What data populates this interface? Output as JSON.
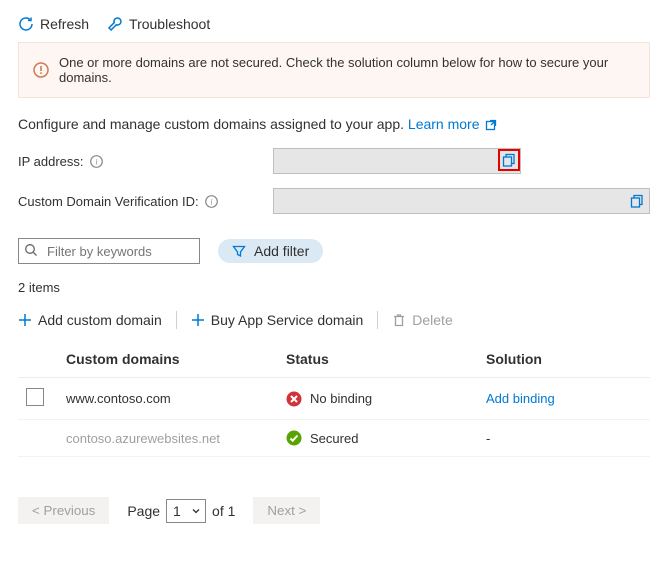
{
  "toolbar": {
    "refresh_label": "Refresh",
    "troubleshoot_label": "Troubleshoot"
  },
  "warning": {
    "message": "One or more domains are not secured. Check the solution column below for how to secure your domains."
  },
  "intro": {
    "text": "Configure and manage custom domains assigned to your app. ",
    "learn_more_label": "Learn more"
  },
  "fields": {
    "ip_label": "IP address:",
    "ip_value": "",
    "cdv_label": "Custom Domain Verification ID:",
    "cdv_value": ""
  },
  "filter": {
    "placeholder": "Filter by keywords",
    "add_filter_label": "Add filter"
  },
  "count_text": "2 items",
  "actions": {
    "add_domain_label": "Add custom domain",
    "buy_domain_label": "Buy App Service domain",
    "delete_label": "Delete"
  },
  "table": {
    "headers": {
      "domain": "Custom domains",
      "status": "Status",
      "solution": "Solution"
    },
    "rows": [
      {
        "selectable": true,
        "domain": "www.contoso.com",
        "status_icon": "error",
        "status_text": "No binding",
        "solution_text": "Add binding",
        "solution_is_link": true,
        "muted": false
      },
      {
        "selectable": false,
        "domain": "contoso.azurewebsites.net",
        "status_icon": "success",
        "status_text": "Secured",
        "solution_text": "-",
        "solution_is_link": false,
        "muted": true
      }
    ]
  },
  "pager": {
    "prev_label": "< Previous",
    "page_label": "Page",
    "current_page": "1",
    "of_label": "of 1",
    "next_label": "Next >"
  }
}
